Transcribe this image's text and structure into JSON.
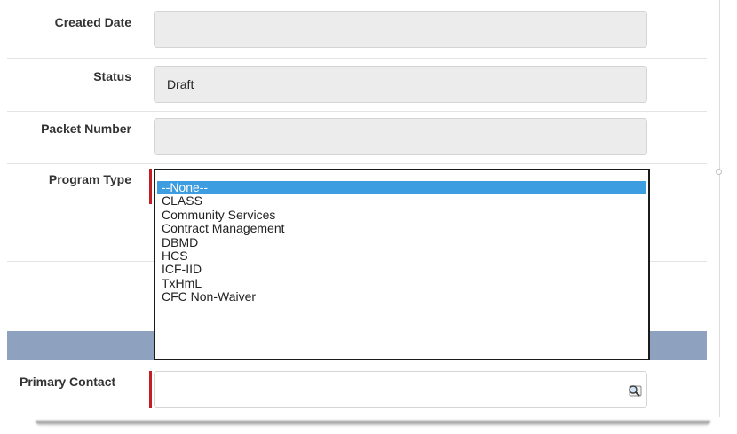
{
  "fields": {
    "created_date": {
      "label": "Created Date",
      "value": ""
    },
    "status": {
      "label": "Status",
      "value": "Draft"
    },
    "packet_number": {
      "label": "Packet Number",
      "value": ""
    },
    "program_type": {
      "label": "Program Type",
      "selected": "--None--"
    },
    "primary_contact": {
      "label": "Primary Contact",
      "value": ""
    }
  },
  "program_type_options": [
    "--None--",
    "CLASS",
    "Community Services",
    "Contract Management",
    "DBMD",
    "HCS",
    "ICF-IID",
    "TxHmL",
    "CFC Non-Waiver"
  ],
  "icons": {
    "lookup": "lookup-magnifier-icon"
  },
  "colors": {
    "required_bar": "#c41e24",
    "selected_option": "#3c9de0",
    "section_band": "#8ea1bf",
    "field_readonly": "#ececec"
  }
}
